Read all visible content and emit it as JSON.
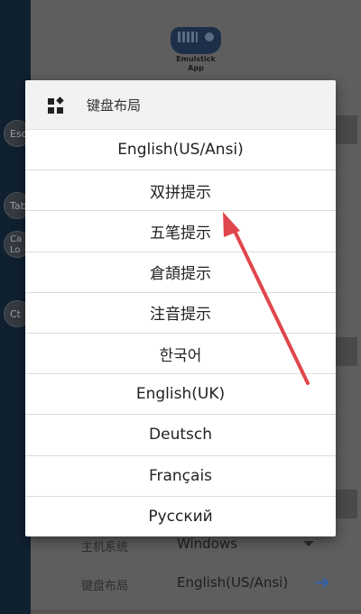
{
  "app": {
    "logo_text_line1": "Emulstick",
    "logo_text_line2": "App"
  },
  "left_strip": {
    "keys": [
      "Esc",
      "Tab",
      "Ca Lo",
      "Ct"
    ]
  },
  "dialog": {
    "title": "键盘布局",
    "options": [
      "English(US/Ansi)",
      "双拼提示",
      "五笔提示",
      "倉頡提示",
      "注音提示",
      "한국어",
      "English(UK)",
      "Deutsch",
      "Français",
      "Русский"
    ]
  },
  "settings": {
    "host_system_label": "主机系统",
    "host_system_value": "Windows",
    "keyboard_layout_label": "键盘布局",
    "keyboard_layout_value": "English(US/Ansi)"
  },
  "colors": {
    "annotation_arrow": "#e0464b",
    "accent": "#2f6fd0"
  }
}
